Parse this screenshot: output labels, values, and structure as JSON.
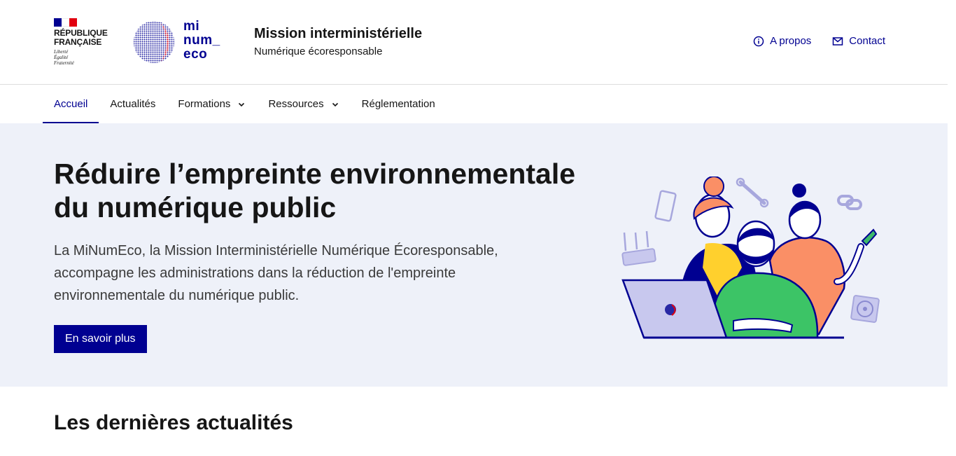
{
  "header": {
    "republic_name": "RÉPUBLIQUE\nFRANÇAISE",
    "republic_motto": "Liberté\nÉgalité\nFraternité",
    "logo_text": "mi\nnum_\neco",
    "service_title": "Mission interministérielle",
    "service_tagline": "Numérique écoresponsable",
    "tools": [
      {
        "label": "A propos",
        "icon": "info-icon"
      },
      {
        "label": "Contact",
        "icon": "mail-icon"
      }
    ]
  },
  "nav": {
    "items": [
      {
        "label": "Accueil",
        "active": true,
        "dropdown": false
      },
      {
        "label": "Actualités",
        "active": false,
        "dropdown": false
      },
      {
        "label": "Formations",
        "active": false,
        "dropdown": true
      },
      {
        "label": "Ressources",
        "active": false,
        "dropdown": true
      },
      {
        "label": "Réglementation",
        "active": false,
        "dropdown": false
      }
    ]
  },
  "hero": {
    "title": "Réduire l’empreinte environnementale du numérique public",
    "text": "La MiNumEco, la Mission Interministérielle Numérique Écoresponsable, accompagne les administrations dans la réduction de l'empreinte environnementale du numérique public.",
    "button_label": "En savoir plus"
  },
  "news": {
    "title": "Les dernières actualités"
  },
  "colors": {
    "primary": "#000091",
    "hero_bg": "#eef1f9",
    "flag_red": "#e1000f"
  }
}
